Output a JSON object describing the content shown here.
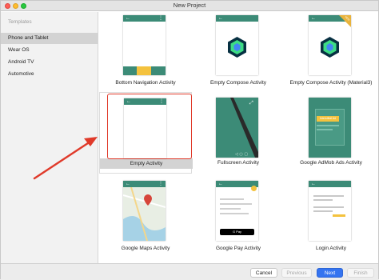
{
  "window": {
    "title": "New Project"
  },
  "sidebar": {
    "header": "Templates",
    "items": [
      {
        "label": "Phone and Tablet",
        "active": true
      },
      {
        "label": "Wear OS",
        "active": false
      },
      {
        "label": "Android TV",
        "active": false
      },
      {
        "label": "Automotive",
        "active": false
      }
    ]
  },
  "gallery": {
    "templates": [
      {
        "label": "Bottom Navigation Activity",
        "icon": "bottom-navigation-preview-icon"
      },
      {
        "label": "Empty Compose Activity",
        "icon": "compose-cube-icon"
      },
      {
        "label": "Empty Compose Activity (Material3)",
        "icon": "compose-cube-material3-icon",
        "badge": "NEW"
      },
      {
        "label": "Empty Activity",
        "icon": "empty-activity-preview-icon",
        "selected": true
      },
      {
        "label": "Fullscreen Activity",
        "icon": "fullscreen-preview-icon"
      },
      {
        "label": "Google AdMob Ads Activity",
        "icon": "admob-preview-icon",
        "ad_text": "Interstitial Ad"
      },
      {
        "label": "Google Maps Activity",
        "icon": "map-preview-icon"
      },
      {
        "label": "Google Pay Activity",
        "icon": "google-pay-preview-icon",
        "pay_text": "G Pay"
      },
      {
        "label": "Login Activity",
        "icon": "login-preview-icon"
      }
    ]
  },
  "footer": {
    "cancel_label": "Cancel",
    "previous_label": "Previous",
    "next_label": "Next",
    "finish_label": "Finish"
  },
  "colors": {
    "accent": "#3574f0",
    "appbar": "#3c8b77",
    "selection": "#e03a2a",
    "annotation_arrow": "#e03a2a"
  }
}
